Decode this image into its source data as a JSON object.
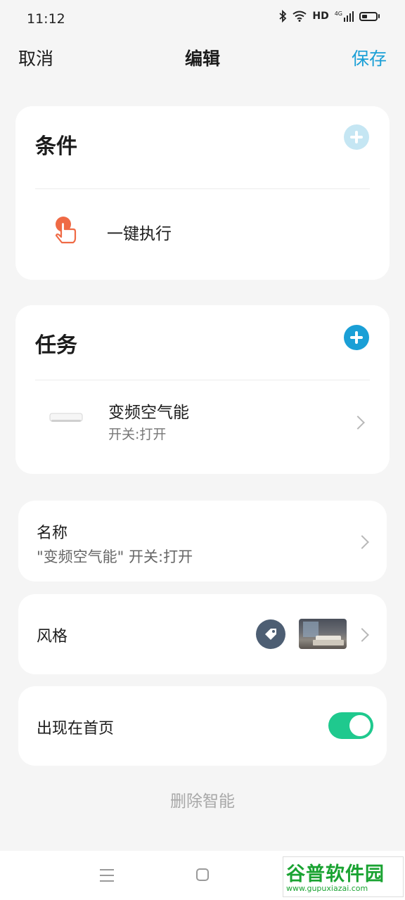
{
  "status_bar": {
    "time": "11:12",
    "icons": [
      "bluetooth-icon",
      "wifi-icon",
      "hd-icon",
      "signal-4g-icon",
      "battery-icon"
    ],
    "hd_label": "HD",
    "network_label": "4G",
    "battery_level": 0.25
  },
  "header": {
    "cancel_label": "取消",
    "title": "编辑",
    "save_label": "保存"
  },
  "condition_card": {
    "title": "条件",
    "item_label": "一键执行",
    "item_icon": "tap-hand-icon"
  },
  "task_card": {
    "title": "任务",
    "item_name": "变频空气能",
    "item_status": "开关:打开",
    "item_icon": "air-conditioner-icon"
  },
  "name_row": {
    "label": "名称",
    "value": "\"变频空气能\" 开关:打开"
  },
  "style_row": {
    "label": "风格",
    "icon": "tag-icon",
    "thumbnail": "bedroom-thumbnail"
  },
  "home_row": {
    "label": "出现在首页",
    "toggle_on": true
  },
  "delete_label": "删除智能",
  "nav_bar": {
    "icons": [
      "menu-icon",
      "home-icon"
    ]
  },
  "watermark": {
    "text": "谷普软件园",
    "url": "www.gupuxiazai.com"
  },
  "colors": {
    "accent": "#1a9fd6",
    "plus_disabled": "#c5e6f3",
    "toggle": "#1fc98e",
    "tap_icon": "#ef6a45",
    "tag_bg": "#4d5e73"
  }
}
